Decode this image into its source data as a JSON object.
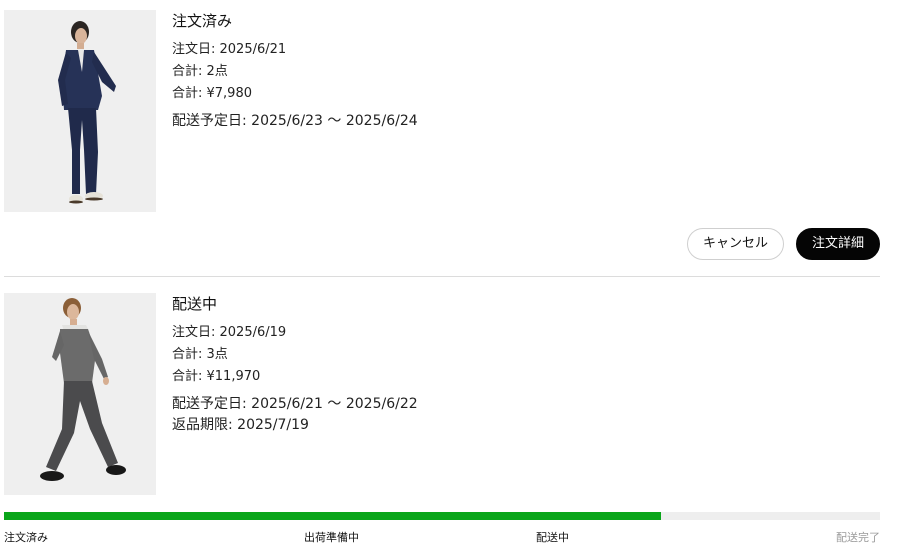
{
  "orders": [
    {
      "status": "注文済み",
      "order_date": "注文日: 2025/6/21",
      "item_count": "合計: 2点",
      "total": "合計: ¥7,980",
      "delivery": "配送予定日: 2025/6/23 〜 2025/6/24",
      "image": "navy-suit-model-photo",
      "actions": {
        "cancel_label": "キャンセル",
        "detail_label": "注文詳細"
      }
    },
    {
      "status": "配送中",
      "order_date": "注文日: 2025/6/19",
      "item_count": "合計: 3点",
      "total": "合計: ¥11,970",
      "delivery": "配送予定日: 2025/6/21 〜 2025/6/22",
      "return_deadline": "返品期限: 2025/7/19",
      "image": "grey-shirt-model-photo",
      "progress": {
        "fraction": 0.75,
        "steps": [
          "注文済み",
          "出荷準備中",
          "配送中",
          "配送完了"
        ],
        "current_step": 3
      }
    }
  ],
  "colors": {
    "progress_fill": "#0aa51a",
    "progress_track": "#eeeeee",
    "primary_button": "#050505",
    "inactive_step": "#9a9a9a"
  }
}
